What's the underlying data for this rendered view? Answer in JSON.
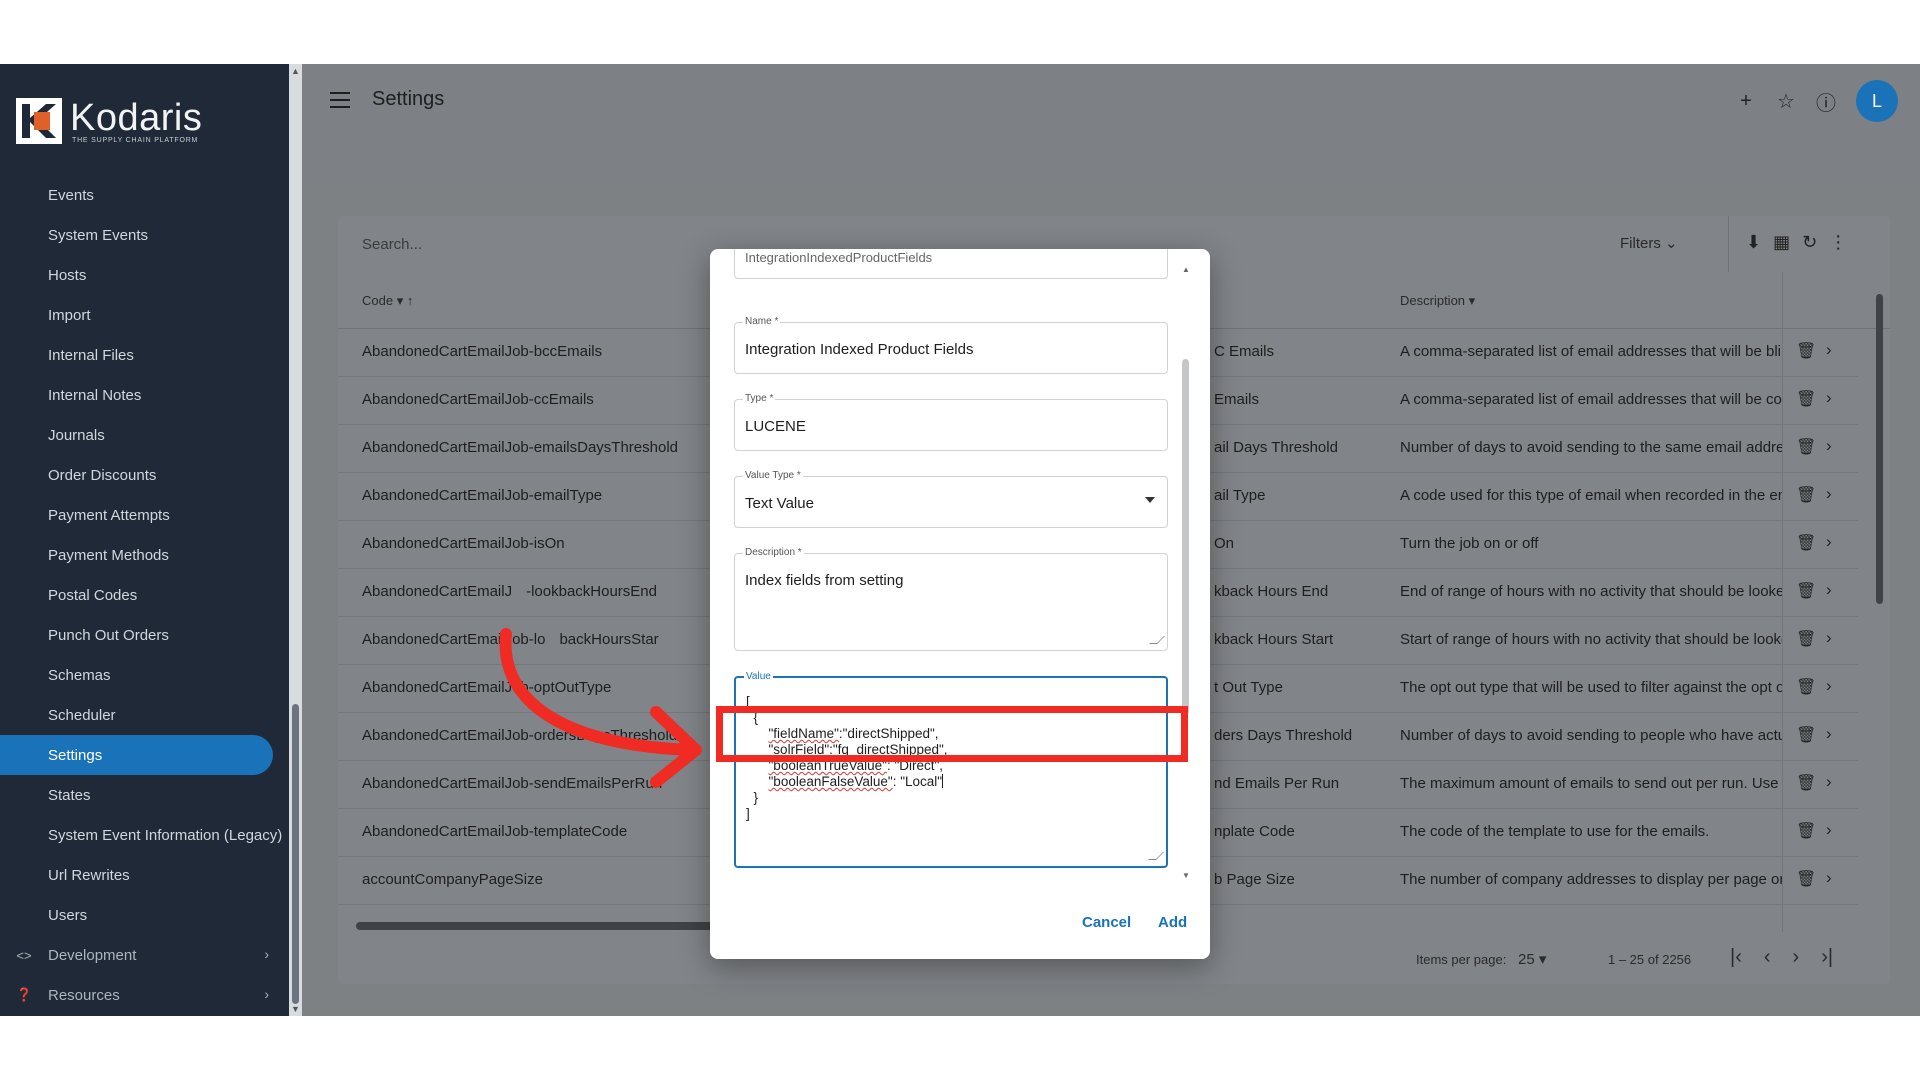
{
  "app": {
    "logo_name": "Kodaris",
    "logo_tagline": "THE SUPPLY CHAIN PLATFORM",
    "page_title": "Settings",
    "avatar_letter": "L",
    "colors": {
      "sidebar_bg": "#1f2937",
      "accent": "#1a73b8",
      "annotation": "#ef2b24"
    }
  },
  "sidebar": {
    "items": [
      {
        "label": "Events"
      },
      {
        "label": "System Events"
      },
      {
        "label": "Hosts"
      },
      {
        "label": "Import"
      },
      {
        "label": "Internal Files"
      },
      {
        "label": "Internal Notes"
      },
      {
        "label": "Journals"
      },
      {
        "label": "Order Discounts"
      },
      {
        "label": "Payment Attempts"
      },
      {
        "label": "Payment Methods"
      },
      {
        "label": "Postal Codes"
      },
      {
        "label": "Punch Out Orders"
      },
      {
        "label": "Schemas"
      },
      {
        "label": "Scheduler"
      },
      {
        "label": "Settings",
        "active": true
      },
      {
        "label": "States"
      },
      {
        "label": "System Event Information (Legacy)"
      },
      {
        "label": "Url Rewrites"
      },
      {
        "label": "Users"
      }
    ],
    "groups": [
      {
        "label": "Development",
        "icon": "code-icon"
      },
      {
        "label": "Resources",
        "icon": "help-circle-icon"
      }
    ]
  },
  "table": {
    "search_placeholder": "Search...",
    "filters_label": "Filters",
    "columns": {
      "code": "Code",
      "description": "Description"
    },
    "rows": [
      {
        "code": "AbandonedCartEmailJob-bccEmails",
        "name": "C Emails",
        "description": "A comma-separated list of email addresses that will be blinc"
      },
      {
        "code": "AbandonedCartEmailJob-ccEmails",
        "name": "Emails",
        "description": "A comma-separated list of email addresses that will be copi"
      },
      {
        "code": "AbandonedCartEmailJob-emailsDaysThreshold",
        "name": "ail Days Threshold",
        "description": "Number of days to avoid sending to the same email address"
      },
      {
        "code": "AbandonedCartEmailJob-emailType",
        "name": "ail Type",
        "description": "A code used for this type of email when recorded in the emai"
      },
      {
        "code": "AbandonedCartEmailJob-isOn",
        "name": "On",
        "description": "Turn the job on or off"
      },
      {
        "code": "AbandonedCartEmailJ",
        "code_tail": "-lookbackHoursEnd",
        "name": "kback Hours End",
        "description": "End of range of hours with no activity that should be looked"
      },
      {
        "code": "AbandonedCartEmailJob-lo",
        "code_tail": "backHoursStar",
        "name": "kback Hours Start",
        "description": "Start of range of hours with no activity that should be lookec"
      },
      {
        "code": "AbandonedCartEmailJob-optOutType",
        "name": "t Out Type",
        "description": "The opt out type that will be used to filter against the opt out"
      },
      {
        "code": "AbandonedCartEmailJob-ordersDaysThreshold",
        "name": "ders Days Threshold",
        "description": "Number of days to avoid sending to people who have actual"
      },
      {
        "code": "AbandonedCartEmailJob-sendEmailsPerRun",
        "name": "nd Emails Per Run",
        "description": "The maximum amount of emails to send out per run. Use this"
      },
      {
        "code": "AbandonedCartEmailJob-templateCode",
        "name": "nplate Code",
        "description": "The code of the template to use for the emails."
      },
      {
        "code": "accountCompanyPageSize",
        "name": "b Page Size",
        "description": "The number of company addresses to display per page on th"
      }
    ],
    "pager": {
      "items_per_page_label": "Items per page:",
      "items_per_page": "25",
      "range": "1 – 25 of 2256"
    }
  },
  "modal": {
    "top_field_value": "IntegrationIndexedProductFields",
    "name_label": "Name *",
    "name_value": "Integration Indexed Product Fields",
    "type_label": "Type *",
    "type_value": "LUCENE",
    "value_type_label": "Value Type *",
    "value_type_value": "Text Value",
    "description_label": "Description *",
    "description_value": "Index fields from setting",
    "value_label": "Value",
    "value_lines": {
      "l1": "[",
      "l2": "  {",
      "l3a": "\"fieldName\"",
      "l3b": ":\"directShipped\",",
      "l4a": "\"solrField\"",
      "l4b": ":\"",
      "l4c": "fq_directShipped",
      "l4d": "\",",
      "l5a": "\"booleanTrueValue\"",
      "l5b": ": \"Direct\",",
      "l6a": "\"booleanFalseValue\"",
      "l6b": ": \"Local\"",
      "l7": "  }",
      "l8": "]"
    },
    "cancel_label": "Cancel",
    "add_label": "Add"
  }
}
